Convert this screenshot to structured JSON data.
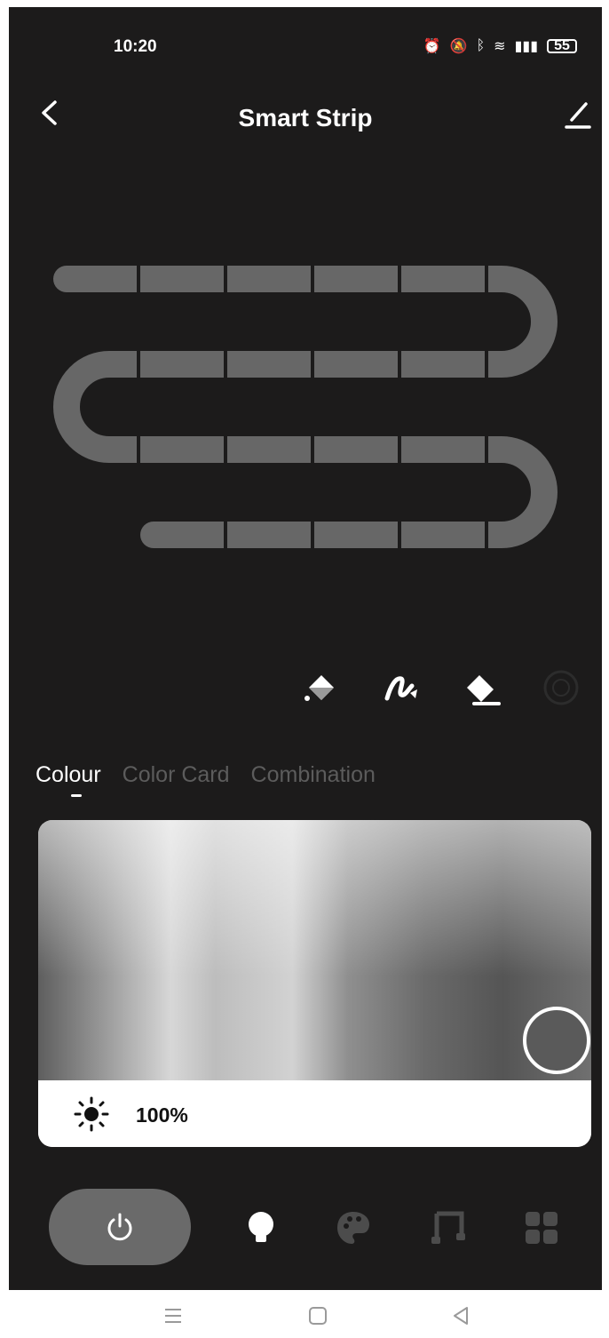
{
  "status_bar": {
    "time": "10:20",
    "battery": "55"
  },
  "header": {
    "title": "Smart Strip"
  },
  "tabs": [
    {
      "label": "Colour",
      "active": true
    },
    {
      "label": "Color Card",
      "active": false
    },
    {
      "label": "Combination",
      "active": false
    }
  ],
  "brightness": {
    "value": "100%"
  },
  "colors": {
    "background": "#1c1b1b",
    "segment": "#676767",
    "power_button": "#6a6a6a"
  },
  "icons": {
    "back": "chevron-left-icon",
    "edit": "pencil-icon",
    "fill": "paint-bucket-icon",
    "draw": "pen-icon",
    "erase": "eraser-icon",
    "extra": "circle-icon",
    "power": "power-icon",
    "bulb": "bulb-icon",
    "palette": "palette-icon",
    "music": "music-icon",
    "scenes": "grid-icon"
  }
}
